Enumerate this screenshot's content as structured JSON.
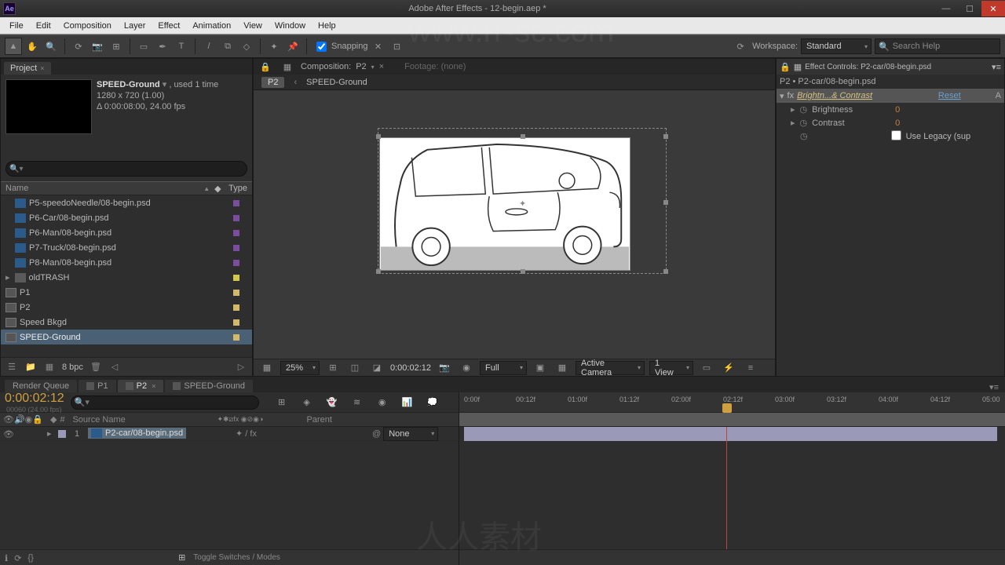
{
  "window": {
    "title": "Adobe After Effects - 12-begin.aep *",
    "logo": "Ae"
  },
  "menu": [
    "File",
    "Edit",
    "Composition",
    "Layer",
    "Effect",
    "Animation",
    "View",
    "Window",
    "Help"
  ],
  "toolbar": {
    "snapping": "Snapping",
    "workspace_label": "Workspace:",
    "workspace": "Standard",
    "search_placeholder": "Search Help"
  },
  "project": {
    "tab": "Project",
    "name": "SPEED-Ground",
    "used": ", used 1 time",
    "res": "1280 x 720 (1.00)",
    "dur": "Δ 0:00:08:00, 24.00 fps",
    "col_name": "Name",
    "col_type": "Type",
    "items": [
      {
        "name": "P5-speedoNeedle/08-begin.psd",
        "type": "ps",
        "tag": "purple"
      },
      {
        "name": "P6-Car/08-begin.psd",
        "type": "ps",
        "tag": "purple"
      },
      {
        "name": "P6-Man/08-begin.psd",
        "type": "ps",
        "tag": "purple"
      },
      {
        "name": "P7-Truck/08-begin.psd",
        "type": "ps",
        "tag": "purple"
      },
      {
        "name": "P8-Man/08-begin.psd",
        "type": "ps",
        "tag": "purple"
      },
      {
        "name": "oldTRASH",
        "type": "folder",
        "tag": "yellow"
      },
      {
        "name": "P1",
        "type": "comp",
        "tag": "sandy"
      },
      {
        "name": "P2",
        "type": "comp",
        "tag": "sandy"
      },
      {
        "name": "Speed Bkgd",
        "type": "comp",
        "tag": "sandy"
      },
      {
        "name": "SPEED-Ground",
        "type": "comp",
        "tag": "sandy",
        "selected": true
      }
    ],
    "bpc": "8 bpc"
  },
  "composition": {
    "tab_label": "Composition:",
    "tab_name": "P2",
    "footage_label": "Footage: (none)",
    "crumb_p2": "P2",
    "crumb_item": "SPEED-Ground",
    "zoom": "25%",
    "timecode": "0:00:02:12",
    "channel": "Full",
    "camera": "Active Camera",
    "view": "1 View"
  },
  "effects": {
    "tab": "Effect Controls: P2-car/08-begin.psd",
    "layer_line": "P2 • P2-car/08-begin.psd",
    "effect_name": "Brightn...& Contrast",
    "reset": "Reset",
    "props": [
      {
        "name": "Brightness",
        "val": "0"
      },
      {
        "name": "Contrast",
        "val": "0"
      }
    ],
    "legacy": "Use Legacy (sup"
  },
  "timeline": {
    "tabs": [
      {
        "label": "Render Queue"
      },
      {
        "label": "P1",
        "closable": true
      },
      {
        "label": "P2",
        "closable": true,
        "active": true
      },
      {
        "label": "SPEED-Ground"
      }
    ],
    "timecode": "0:00:02:12",
    "frameinfo": "00060 (24.00 fps)",
    "col_num": "#",
    "col_source": "Source Name",
    "col_parent": "Parent",
    "layer_idx": "1",
    "layer_name": "P2-car/08-begin.psd",
    "parent_val": "None",
    "ticks": [
      "0:00f",
      "00:12f",
      "01:00f",
      "01:12f",
      "02:00f",
      "02:12f",
      "03:00f",
      "03:12f",
      "04:00f",
      "04:12f",
      "05:00"
    ],
    "toggle": "Toggle Switches / Modes"
  }
}
